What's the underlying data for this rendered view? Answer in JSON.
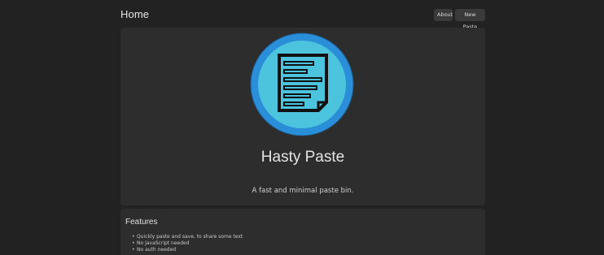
{
  "header": {
    "title": "Home",
    "about_label": "About",
    "new_paste_label": "New Paste"
  },
  "hero": {
    "logo_icon": "document-icon",
    "app_name": "Hasty Paste",
    "tagline": "A fast and minimal paste bin."
  },
  "features": {
    "title": "Features",
    "items": [
      "Quickly paste and save, to share some text",
      "No JavaScript needed",
      "No auth needed"
    ]
  },
  "colors": {
    "background": "#222222",
    "card": "#2d2d2d",
    "logo_outer": "#2a8fd8",
    "logo_inner": "#4cc4de",
    "button": "#3a3a3a"
  }
}
